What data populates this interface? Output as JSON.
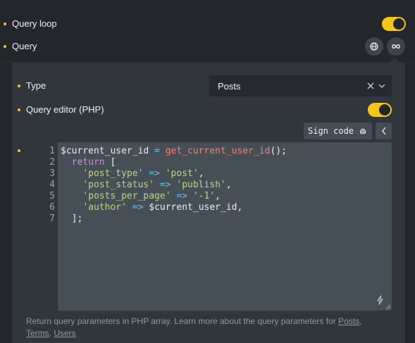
{
  "controls": {
    "query_loop_label": "Query loop",
    "query_loop_on": true,
    "query_label": "Query"
  },
  "panel": {
    "type_label": "Type",
    "type_value": "Posts",
    "editor_label": "Query editor (PHP)",
    "editor_on": true,
    "sign_code_label": "Sign code",
    "code_lines": [
      {
        "num": "1"
      },
      {
        "num": "2"
      },
      {
        "num": "3"
      },
      {
        "num": "4"
      },
      {
        "num": "5"
      },
      {
        "num": "6"
      },
      {
        "num": "7"
      }
    ],
    "code": {
      "l1_var": "$current_user_id",
      "l1_eq": " = ",
      "l1_fn": "get_current_user_id",
      "l1_end": "();",
      "l2_kw": "return",
      "l2_end": " [",
      "l3_key": "'post_type'",
      "l3_arrow": " => ",
      "l3_val": "'post'",
      "l3_end": ",",
      "l4_key": "'post_status'",
      "l4_arrow": " => ",
      "l4_val": "'publish'",
      "l4_end": ",",
      "l5_key": "'posts_per_page'",
      "l5_arrow": " => ",
      "l5_val": "'-1'",
      "l5_end": ",",
      "l6_key": "'author'",
      "l6_arrow": " => ",
      "l6_val": "$current_user_id",
      "l6_end": ",",
      "l7": "];"
    },
    "help_text": "Return query parameters in PHP array. Learn more about the query parameters for ",
    "help_links": {
      "posts": "Posts",
      "terms": "Terms",
      "users": "Users"
    },
    "help_sep1": ",",
    "help_sep2": ", "
  },
  "colors": {
    "accent": "#f5c518",
    "background": "#23262a",
    "panel": "#31363c",
    "editor": "#464e56"
  },
  "icons": [
    "globe-icon",
    "infinity-icon",
    "clear-icon",
    "chevron-down-icon",
    "fingerprint-icon",
    "chevron-left-icon",
    "bolt-icon",
    "resize-handle-icon"
  ]
}
